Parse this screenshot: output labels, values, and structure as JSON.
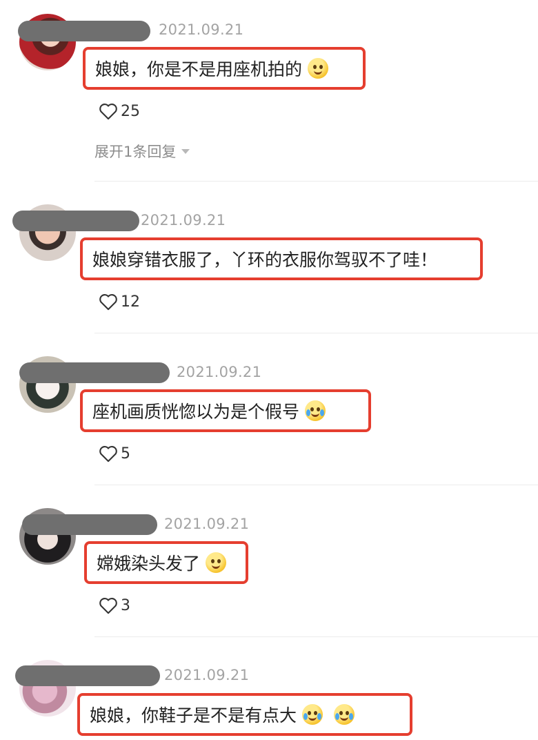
{
  "comments": [
    {
      "date": "2021.09.21",
      "text": "娘娘，你是不是用座机拍的",
      "emoji": "pleading-face-icon",
      "likes": "25",
      "expand": "展开1条回复"
    },
    {
      "date": "2021.09.21",
      "text": "娘娘穿错衣服了，丫环的衣服你驾驭不了哇！",
      "likes": "12"
    },
    {
      "date": "2021.09.21",
      "text": "座机画质恍惚以为是个假号",
      "emoji": "crying-laughing-icon",
      "likes": "5"
    },
    {
      "date": "2021.09.21",
      "text": "嫦娥染头发了",
      "emoji": "grinning-face-icon",
      "likes": "3"
    },
    {
      "date": "2021.09.21",
      "text": "娘娘，你鞋子是不是有点大",
      "emoji": "crying-laughing-icon"
    }
  ],
  "colors": {
    "highlight_border": "#e53e2f",
    "name_redaction": "#6f6f6f",
    "date_text": "#a3a3a3"
  }
}
